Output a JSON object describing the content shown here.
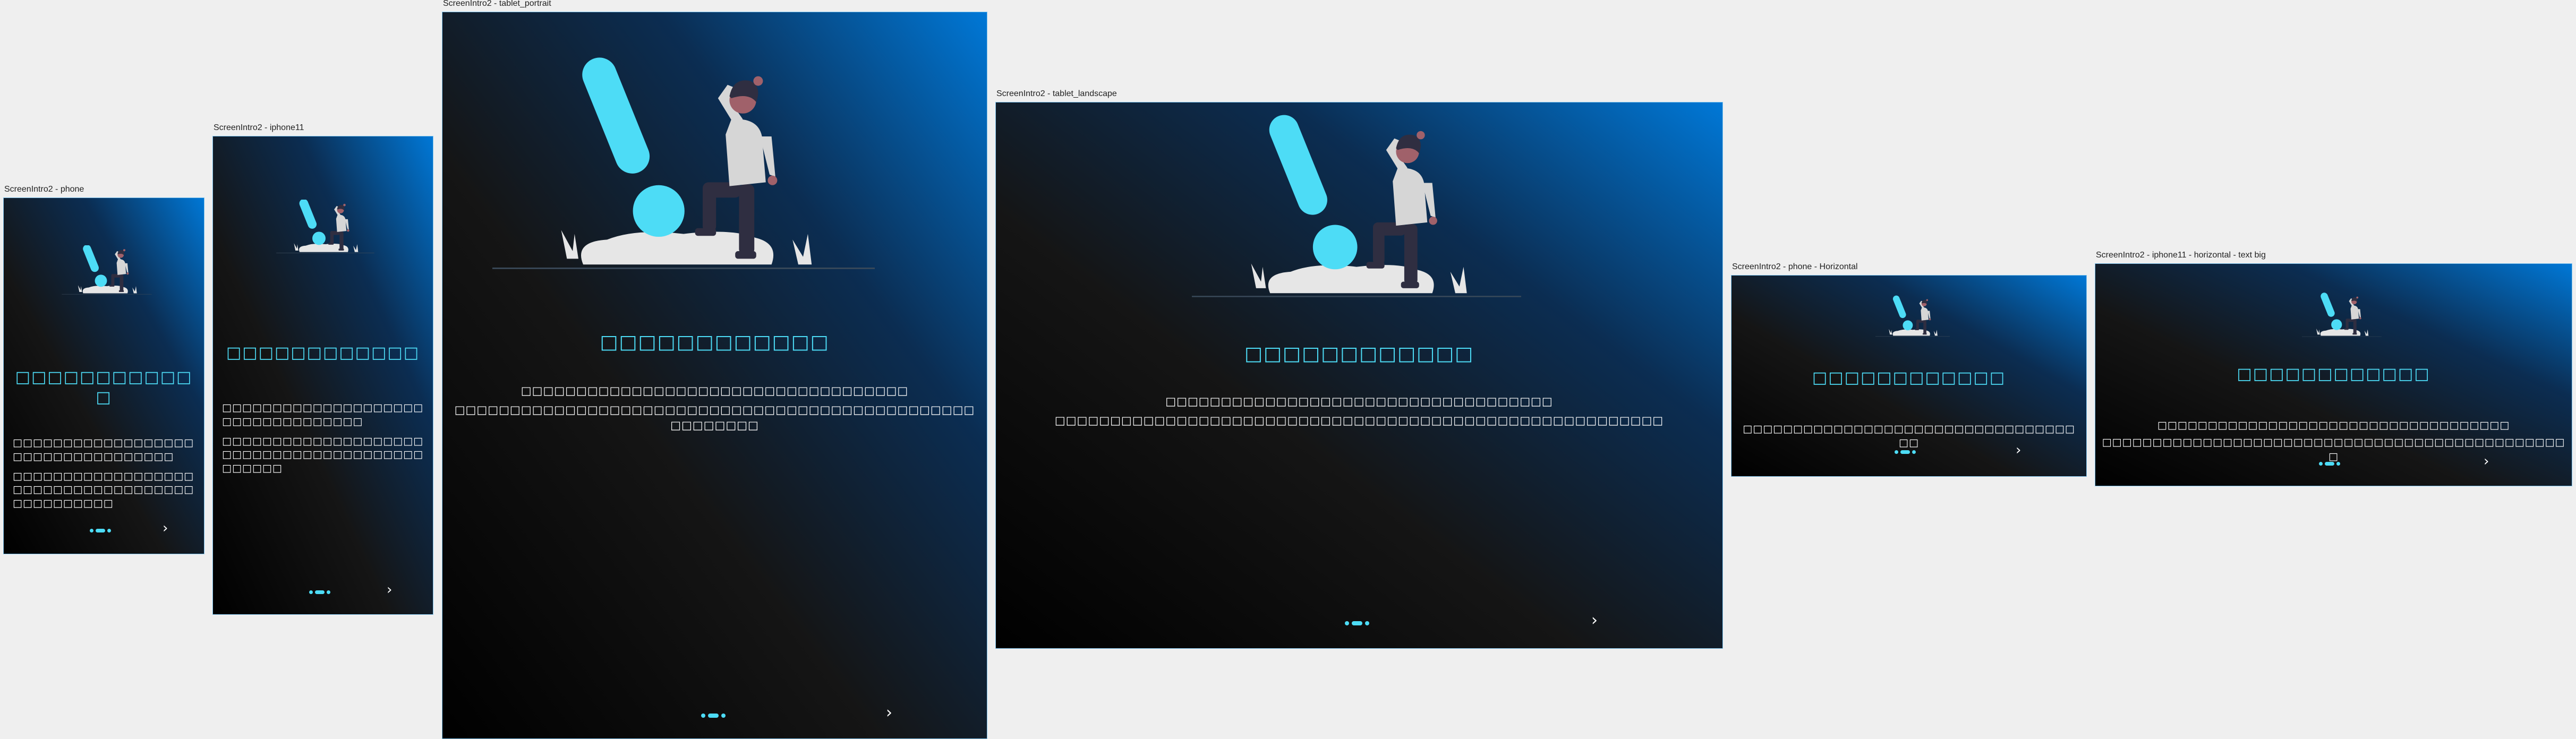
{
  "frames": [
    {
      "label": "ScreenIntro2 - phone",
      "title": "□□□□□□□□□□□□",
      "body": [
        "□□□□□□□□□□□□□□□□□□□□□□□□□□□□□□□□□□",
        "□□□□□□□□□□□□□□□□□□□□□□□□□□□□□□□□□□□□□□□□□□□□□□"
      ],
      "next_label": "›"
    },
    {
      "label": "ScreenIntro2 - iphone11",
      "title": "□□□□□□□□□□□□",
      "body": [
        "□□□□□□□□□□□□□□□□□□□□□□□□□□□□□□□□□□",
        "□□□□□□□□□□□□□□□□□□□□□□□□□□□□□□□□□□□□□□□□□□□□□□"
      ],
      "next_label": "›"
    },
    {
      "label": "ScreenIntro2 - tablet_portrait",
      "title": "□□□□□□□□□□□□",
      "body": [
        "□□□□□□□□□□□□□□□□□□□□□□□□□□□□□□□□□□□",
        "□□□□□□□□□□□□□□□□□□□□□□□□□□□□□□□□□□□□□□□□□□□□□□□□□□□□□□□"
      ],
      "next_label": "›"
    },
    {
      "label": "ScreenIntro2 - tablet_landscape",
      "title": "□□□□□□□□□□□□",
      "body": [
        "□□□□□□□□□□□□□□□□□□□□□□□□□□□□□□□□□□□",
        "□□□□□□□□□□□□□□□□□□□□□□□□□□□□□□□□□□□□□□□□□□□□□□□□□□□□□□□"
      ],
      "next_label": "›"
    },
    {
      "label": "ScreenIntro2 - phone - Horizontal",
      "title": "□□□□□□□□□□□□",
      "body": [
        "□□□□□□□□□□□□□□□□□□□□□□□□□□□□□□□□□□□"
      ],
      "next_label": "›"
    },
    {
      "label": "ScreenIntro2 - iphone11 - horizontal - text big",
      "title": "□□□□□□□□□□□□",
      "body": [
        "□□□□□□□□□□□□□□□□□□□□□□□□□□□□□□□□□□□",
        "□□□□□□□□□□□□□□□□□□□□□□□□□□□□□□□□□□□□□□□□□□□□□□□"
      ],
      "next_label": "›"
    }
  ],
  "theme": {
    "accent": "#4ddcf6",
    "gradient_top": "#0078d7",
    "gradient_bottom": "#000000",
    "text": "#ffffff"
  },
  "icons": [
    "exclamation-illustration",
    "person-illustration",
    "page-indicator-dots",
    "chevron-right-icon"
  ]
}
